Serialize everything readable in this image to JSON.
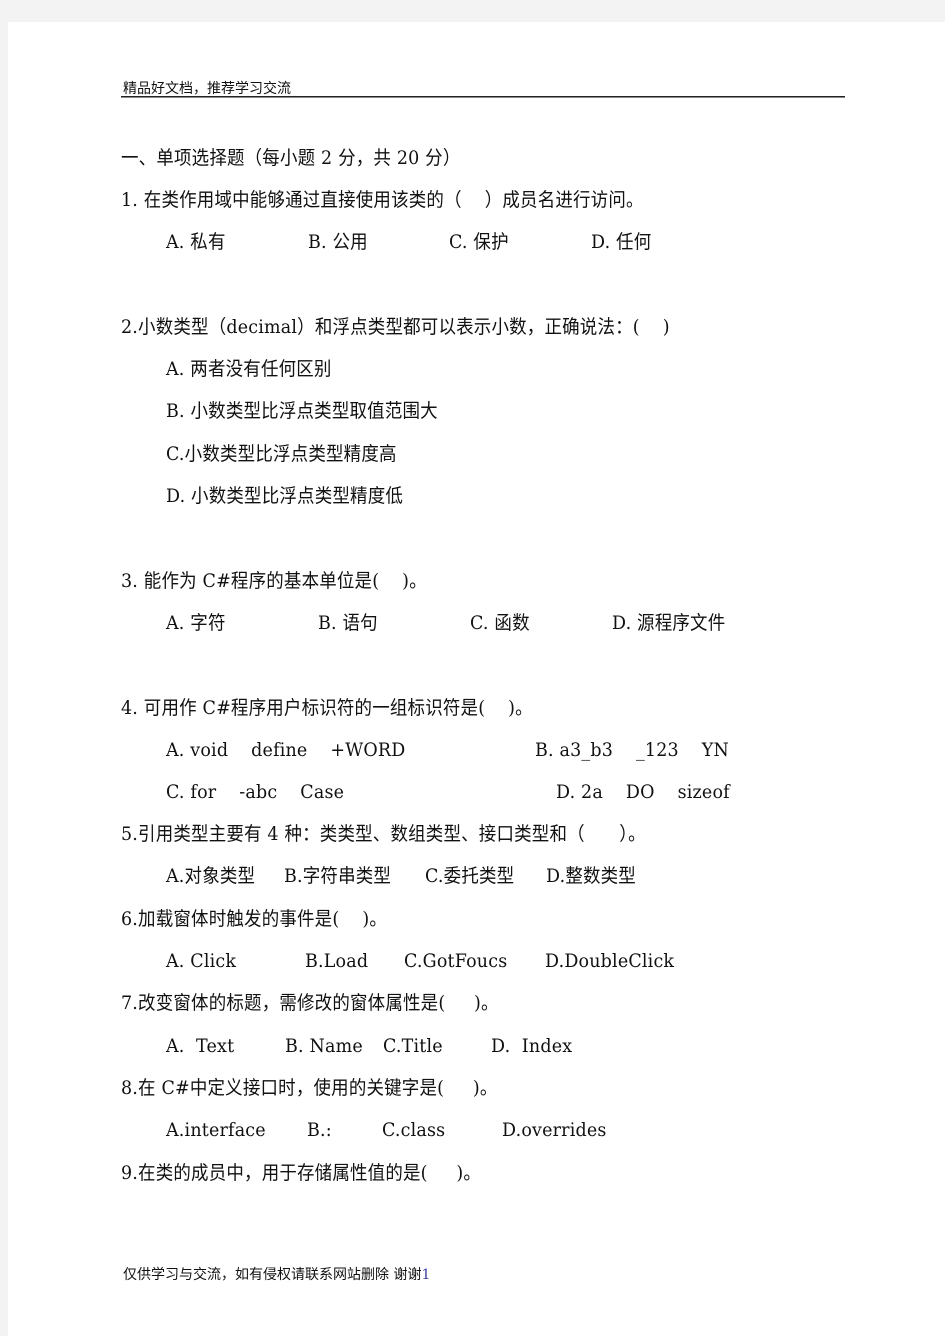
{
  "header": {
    "text": "精品好文档，推荐学习交流"
  },
  "section_title": "一、单项选择题（每小题 2 分，共 20 分）",
  "questions": [
    {
      "stem": "1. 在类作用域中能够通过直接使用该类的（    ）成员名进行访问。",
      "options": [
        "A. 私有",
        "B. 公用",
        "C. 保护",
        "D. 任何"
      ]
    },
    {
      "stem": "2.小数类型（decimal）和浮点类型都可以表示小数，正确说法：(    )",
      "options": [
        "A. 两者没有任何区别",
        "B. 小数类型比浮点类型取值范围大",
        "C.小数类型比浮点类型精度高",
        "D. 小数类型比浮点类型精度低"
      ]
    },
    {
      "stem": "3. 能作为 C#程序的基本单位是(    )。",
      "options": [
        "A. 字符",
        "B. 语句",
        "C. 函数",
        "D. 源程序文件"
      ]
    },
    {
      "stem": "4. 可用作 C#程序用户标识符的一组标识符是(    )。",
      "options": [
        "A. void    define    +WORD",
        "B. a3_b3    _123    YN",
        "C. for    -abc    Case",
        "D. 2a    DO    sizeof"
      ]
    },
    {
      "stem": "5.引用类型主要有 4 种：类类型、数组类型、接口类型和（      ）。",
      "options": [
        "A.对象类型",
        "B.字符串类型",
        "C.委托类型",
        "D.整数类型"
      ]
    },
    {
      "stem": "6.加载窗体时触发的事件是(    )。",
      "options": [
        "A. Click",
        "B.Load",
        "C.GotFoucs",
        "D.DoubleClick"
      ]
    },
    {
      "stem": "7.改变窗体的标题，需修改的窗体属性是(     )。",
      "options": [
        "A.  Text",
        "B. Name",
        "C.Title",
        "D.  Index"
      ]
    },
    {
      "stem": "8.在 C#中定义接口时，使用的关键字是(     )。",
      "options": [
        "A.interface",
        "B.:",
        "C.class",
        "D.overrides"
      ]
    },
    {
      "stem": "9.在类的成员中，用于存储属性值的是(     )。",
      "options": []
    }
  ],
  "footer": {
    "text": "仅供学习与交流，如有侵权请联系网站删除 谢谢",
    "page_number": "1"
  }
}
